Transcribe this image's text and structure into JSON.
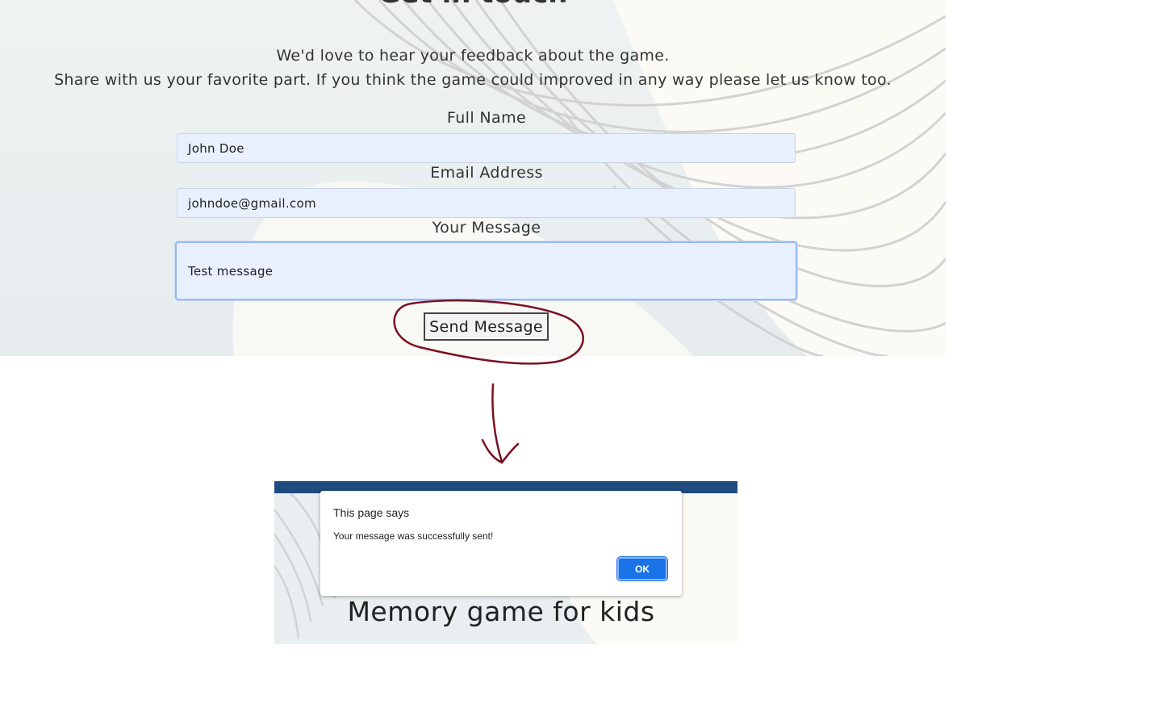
{
  "contact_form": {
    "heading": "Get in touch",
    "intro_line_1": "We'd love to hear your feedback about the game.",
    "intro_line_2": "Share with us your favorite part. If you think the game could improved in any way please let us know too.",
    "full_name_label": "Full Name",
    "full_name_value": "John Doe",
    "email_label": "Email Address",
    "email_value": "johndoe@gmail.com",
    "message_label": "Your Message",
    "message_value": "Test message",
    "send_button_label": "Send Message"
  },
  "annotation": {
    "highlight_color": "#7a1020",
    "shapes": [
      "circle-around-send-button",
      "down-arrow"
    ]
  },
  "alert_screen": {
    "navbar_color": "#1f4b7f",
    "dialog_title": "This page says",
    "dialog_message": "Your message was successfully sent!",
    "ok_label": "OK",
    "ok_color": "#1a73e8",
    "page_title": "Memory game for kids"
  }
}
